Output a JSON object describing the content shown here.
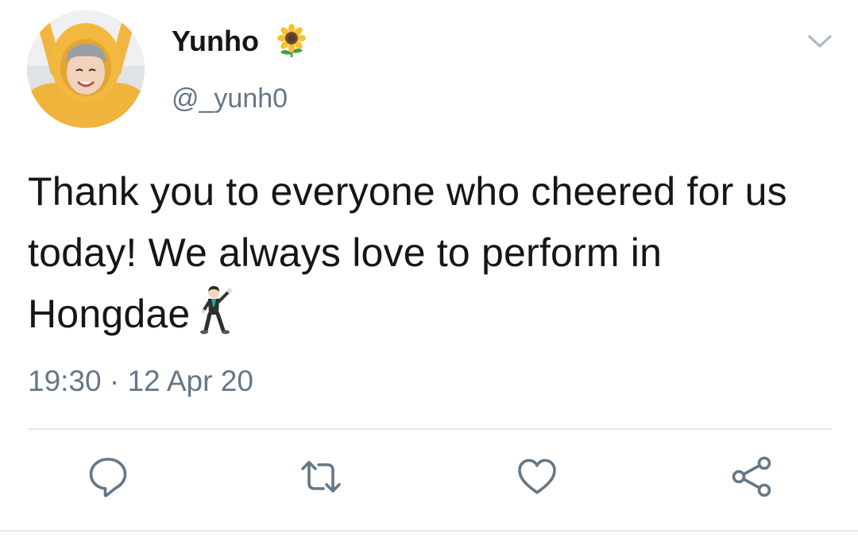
{
  "tweet": {
    "author": {
      "name": "Yunho",
      "badge_emoji": "sunflower-emoji",
      "handle": "@_yunh0",
      "avatar": "avatar-photo"
    },
    "text": "Thank you to everyone who cheered for us today! We always love to perform in Hongdae",
    "trailing_emoji": "man-dancing-emoji",
    "time": "19:30",
    "separator": "·",
    "date": "12 Apr 20",
    "menu_icon": "chevron-down-icon",
    "actions": [
      {
        "name": "reply",
        "icon": "reply-icon"
      },
      {
        "name": "retweet",
        "icon": "retweet-icon"
      },
      {
        "name": "like",
        "icon": "heart-icon"
      },
      {
        "name": "share",
        "icon": "share-icon"
      }
    ],
    "colors": {
      "text": "#14171a",
      "secondary": "#657786",
      "icon": "#657786",
      "divider": "#e1e8ed"
    }
  }
}
